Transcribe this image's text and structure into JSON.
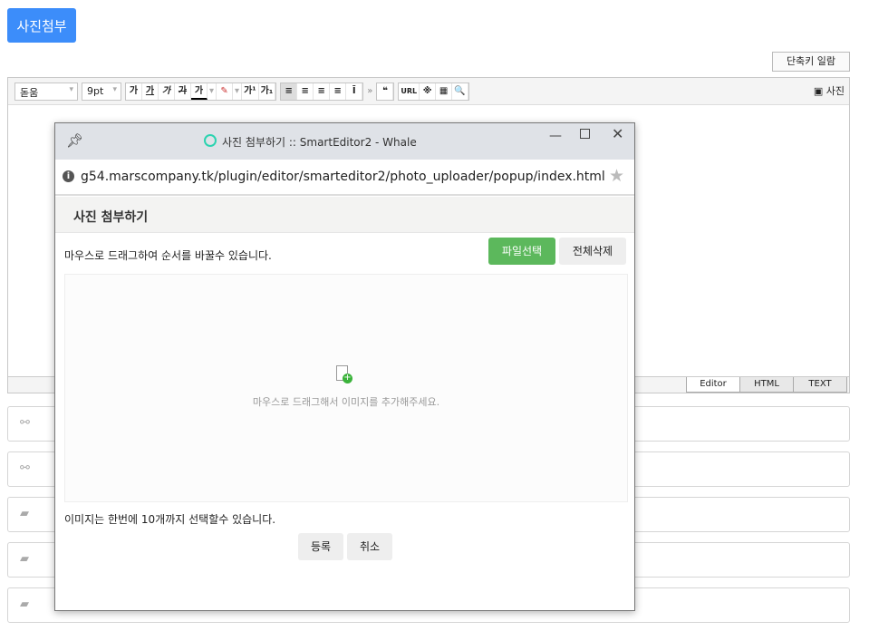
{
  "page": {
    "attach_button": "사진첨부",
    "shortcut_button": "단축키 일람"
  },
  "toolbar": {
    "font": "돋움",
    "size": "9pt",
    "buttons": [
      "가",
      "가",
      "가",
      "가",
      "가",
      "▾",
      "✎",
      "▾",
      "가¹",
      "가₁"
    ],
    "align": [
      "≡",
      "≡",
      "≡",
      "≡",
      "Ī"
    ],
    "more": "»",
    "quote": "❝",
    "misc": [
      "URL",
      "※",
      "▦",
      "🔍"
    ],
    "photo": "사진"
  },
  "editor_tabs": [
    "Editor",
    "HTML",
    "TEXT"
  ],
  "rows": [
    {
      "icon": "link-icon"
    },
    {
      "icon": "link-icon"
    },
    {
      "icon": "folder-icon"
    },
    {
      "icon": "folder-icon"
    },
    {
      "icon": "folder-icon"
    }
  ],
  "popup": {
    "window_title": "사진 첨부하기 :: SmartEditor2 - Whale",
    "url": "g54.marscompany.tk/plugin/editor/smarteditor2/photo_uploader/popup/index.html",
    "heading": "사진 첨부하기",
    "instruction": "마우스로 드래그하여 순서를 바꿀수 있습니다.",
    "select_files": "파일선택",
    "delete_all": "전체삭제",
    "drop_hint": "마우스로 드래그해서 이미지를 추가해주세요.",
    "limit_note": "이미지는 한번에 10개까지 선택할수 있습니다.",
    "register": "등록",
    "cancel": "취소"
  },
  "colors": {
    "primary": "#3c8dfa",
    "success": "#5cb85c"
  }
}
